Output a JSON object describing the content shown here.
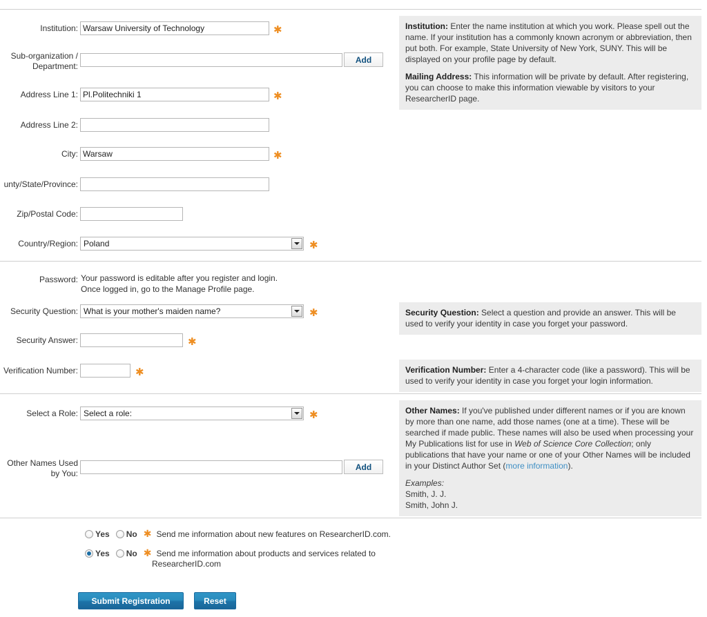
{
  "form": {
    "fields": [
      {
        "id": "institution",
        "label": "Institution:",
        "value": "Warsaw University of Technology",
        "placeholder": "",
        "required": true,
        "type": "text"
      },
      {
        "id": "suborg",
        "label": "Sub-organization / Department:",
        "value": "",
        "placeholder": "",
        "required": false,
        "type": "text-add",
        "add_label": "Add"
      },
      {
        "id": "address1",
        "label": "Address Line 1:",
        "value": "Pl.Politechniki 1",
        "placeholder": "",
        "required": true,
        "type": "text"
      },
      {
        "id": "address2",
        "label": "Address Line 2:",
        "value": "",
        "placeholder": "",
        "required": false,
        "type": "text"
      },
      {
        "id": "city",
        "label": "City:",
        "value": "Warsaw",
        "placeholder": "",
        "required": true,
        "type": "text"
      },
      {
        "id": "county",
        "label": "unty/State/Province:",
        "value": "",
        "placeholder": "",
        "required": false,
        "type": "text"
      },
      {
        "id": "zip",
        "label": "Zip/Postal Code:",
        "value": "",
        "placeholder": "",
        "required": false,
        "type": "text"
      },
      {
        "id": "country",
        "label": "Country/Region:",
        "value": "Poland",
        "required": true,
        "type": "select"
      }
    ],
    "password": {
      "label": "Password:",
      "line1": "Your password is editable after you register and login.",
      "line2": "Once logged in, go to the Manage Profile page."
    },
    "security_question": {
      "label": "Security Question:",
      "value": "What is your mother's maiden name?",
      "required": true
    },
    "security_answer": {
      "label": "Security Answer:",
      "value": "",
      "required": true
    },
    "verification_number": {
      "label": "Verification Number:",
      "value": "",
      "required": true
    },
    "role": {
      "label": "Select a Role:",
      "value": "Select a role:",
      "required": true
    },
    "other_names": {
      "label_line1": "Other Names Used",
      "label_line2": "by You:",
      "value": "",
      "add_label": "Add"
    }
  },
  "help": {
    "address_panel": {
      "p1_title": "Institution:",
      "p1_body": " Enter the name institution at which you work. Please spell out the name. If your institution has a commonly known acronym or abbreviation, then put both. For example, State University of New York, SUNY. This will be displayed on your profile page by default.",
      "p2_title": "Mailing Address:",
      "p2_body": " This information will be private by default. After registering, you can choose to make this information viewable by visitors to your ResearcherID page."
    },
    "security_question_panel": {
      "title": "Security Question:",
      "body": " Select a question and provide an answer. This will be used to verify your identity in case you forget your password."
    },
    "verification_panel": {
      "title": "Verification Number:",
      "body": " Enter a 4-character code (like a password). This will be used to verify your identity in case you forget your login information."
    },
    "other_names_panel": {
      "title": "Other Names:",
      "body_part1": " If you've published under different names or if you are known by more than one name, add those names (one at a time). These will be searched if made public. These names will also be used when processing your My Publications list for use in ",
      "italic_term": "Web of Science Core Collection",
      "body_part2": "; only publications that have your name or one of your Other Names will be included in your Distinct Author Set (",
      "link_text": "more information",
      "body_part3": ").",
      "examples_label": "Examples:",
      "example1": "Smith, J. J.",
      "example2": "Smith, John J."
    }
  },
  "optin": {
    "row1": {
      "yes_label": "Yes",
      "no_label": "No",
      "description": "Send me information about new features on ResearcherID.com.",
      "selected": ""
    },
    "row2": {
      "yes_label": "Yes",
      "no_label": "No",
      "description_line1": "Send me information about products and services related to",
      "description_line2": "ResearcherID.com",
      "selected": "yes"
    }
  },
  "actions": {
    "submit_label": "Submit Registration",
    "reset_label": "Reset"
  },
  "colors": {
    "required_asterisk": "#ee8e22",
    "help_panel_bg": "#ececec",
    "button_blue": "#2a8cbd",
    "link_blue": "#3f8fc4",
    "add_button_text": "#11517f"
  }
}
